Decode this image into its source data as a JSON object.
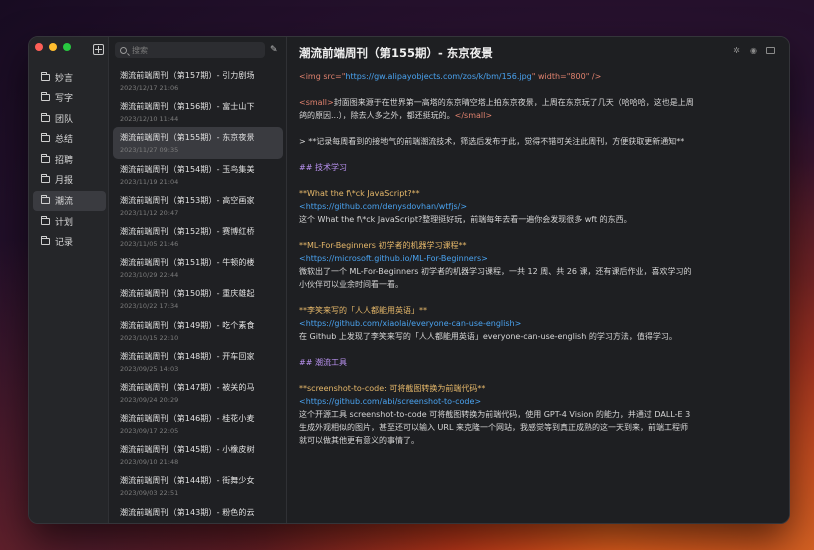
{
  "sidebar": {
    "folders": [
      {
        "label": "妙言",
        "active": false
      },
      {
        "label": "写字",
        "active": false
      },
      {
        "label": "团队",
        "active": false
      },
      {
        "label": "总结",
        "active": false
      },
      {
        "label": "招聘",
        "active": false
      },
      {
        "label": "月报",
        "active": false
      },
      {
        "label": "潮流",
        "active": true
      },
      {
        "label": "计划",
        "active": false
      },
      {
        "label": "记录",
        "active": false
      }
    ]
  },
  "list": {
    "search_placeholder": "搜索",
    "items": [
      {
        "title": "潮流前端周刊（第157期）- 引力剧场",
        "date": "2023/12/17 21:06"
      },
      {
        "title": "潮流前端周刊（第156期）- 富士山下",
        "date": "2023/12/10 11:44"
      },
      {
        "title": "潮流前端周刊（第155期）- 东京夜景",
        "date": "2023/11/27 09:35"
      },
      {
        "title": "潮流前端周刊（第154期）- 玉鸟集美",
        "date": "2023/11/19 21:04"
      },
      {
        "title": "潮流前端周刊（第153期）- 高空画家",
        "date": "2023/11/12 20:47"
      },
      {
        "title": "潮流前端周刊（第152期）- 赛博红桥",
        "date": "2023/11/05 21:46"
      },
      {
        "title": "潮流前端周刊（第151期）- 牛顿的楼",
        "date": "2023/10/29 22:44"
      },
      {
        "title": "潮流前端周刊（第150期）- 重庆雄起",
        "date": "2023/10/22 17:34"
      },
      {
        "title": "潮流前端周刊（第149期）- 吃个素食",
        "date": "2023/10/15 22:10"
      },
      {
        "title": "潮流前端周刊（第148期）- 开车回家",
        "date": "2023/09/25 14:03"
      },
      {
        "title": "潮流前端周刊（第147期）- 被关的马",
        "date": "2023/09/24 20:29"
      },
      {
        "title": "潮流前端周刊（第146期）- 桂花小麦",
        "date": "2023/09/17 22:05"
      },
      {
        "title": "潮流前端周刊（第145期）- 小橡皮树",
        "date": "2023/09/10 21:48"
      },
      {
        "title": "潮流前端周刊（第144期）- 街舞少女",
        "date": "2023/09/03 22:51"
      },
      {
        "title": "潮流前端周刊（第143期）- 粉色的云",
        "date": ""
      }
    ]
  },
  "editor": {
    "title": "潮流前端周刊（第155期）- 东京夜景",
    "img_prefix": "<img src=\"",
    "img_url": "https://gw.alipayobjects.com/zos/k/bm/156.jpg",
    "img_suffix": "\" width=\"800\" />",
    "small_open": "<small>",
    "small_text_1": "封面图来源于在世界第一高塔的东京晴空塔上拍东京夜景，上周在东京玩了几天（哈哈哈，这也是上周",
    "small_text_2": "鸽的原因...），除去人多之外，都还挺玩的。",
    "small_close": "</small>",
    "quote": "> **记录每周看到的接地气的前端潮流技术，筛选后发布于此，觉得不错可关注此周刊，方便获取更新通知**",
    "h2_1": "## 技术学习",
    "a1_title": "**What the f\\*ck JavaScript?**",
    "a1_link": "<https://github.com/denysdovhan/wtfjs/>",
    "a1_desc": "这个 What the f\\*ck JavaScript?整理挺好玩，前端每年去看一遍你会发现很多 wft 的东西。",
    "a2_title": "**ML-For-Beginners 初学者的机器学习课程**",
    "a2_link": "<https://microsoft.github.io/ML-For-Beginners>",
    "a2_desc_1": "微软出了一个 ML-For-Beginners 初学者的机器学习课程，一共 12 周、共 26 课，还有课后作业，喜欢学习的",
    "a2_desc_2": "小伙伴可以业余时间看一看。",
    "a3_title": "**李笑来写的「人人都能用英语」**",
    "a3_link": "<https://github.com/xiaolai/everyone-can-use-english>",
    "a3_desc": "在 Github 上发现了李笑来写的「人人都能用英语」everyone-can-use-english 的学习方法，值得学习。",
    "h2_2": "## 潮流工具",
    "a4_title": "**screenshot-to-code: 可将截图转换为前端代码**",
    "a4_link": "<https://github.com/abi/screenshot-to-code>",
    "a4_desc_1": "这个开源工具 screenshot-to-code 可将截图转换为前端代码，使用 GPT-4 Vision 的能力，并通过 DALL-E 3",
    "a4_desc_2": "生成外观相似的图片，甚至还可以输入 URL 来克隆一个网站，我感觉等到真正成熟的这一天到来，前端工程师",
    "a4_desc_3": "就可以做其他更有意义的事情了。"
  }
}
